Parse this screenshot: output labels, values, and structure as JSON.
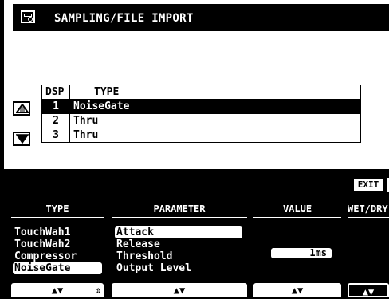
{
  "title": "SAMPLING/FILE IMPORT",
  "dsp_table": {
    "headers": [
      "DSP",
      "TYPE"
    ],
    "rows": [
      {
        "num": "1",
        "type": "NoiseGate"
      },
      {
        "num": "2",
        "type": "Thru"
      },
      {
        "num": "3",
        "type": "Thru"
      }
    ]
  },
  "exit_label": "EXIT",
  "columns": {
    "type": "TYPE",
    "parameter": "PARAMETER",
    "value": "VALUE",
    "wetdry": "WET/DRY"
  },
  "type_list": [
    "TouchWah1",
    "TouchWah2",
    "Compressor",
    "NoiseGate"
  ],
  "param_list": [
    "Attack",
    "Release",
    "Threshold",
    "Output Level"
  ],
  "value": "1ms",
  "arrows": {
    "type": "▲▼",
    "type_spin": "⇕",
    "param": "▲▼",
    "value": "▲▼",
    "wetdry": "▲▼"
  }
}
